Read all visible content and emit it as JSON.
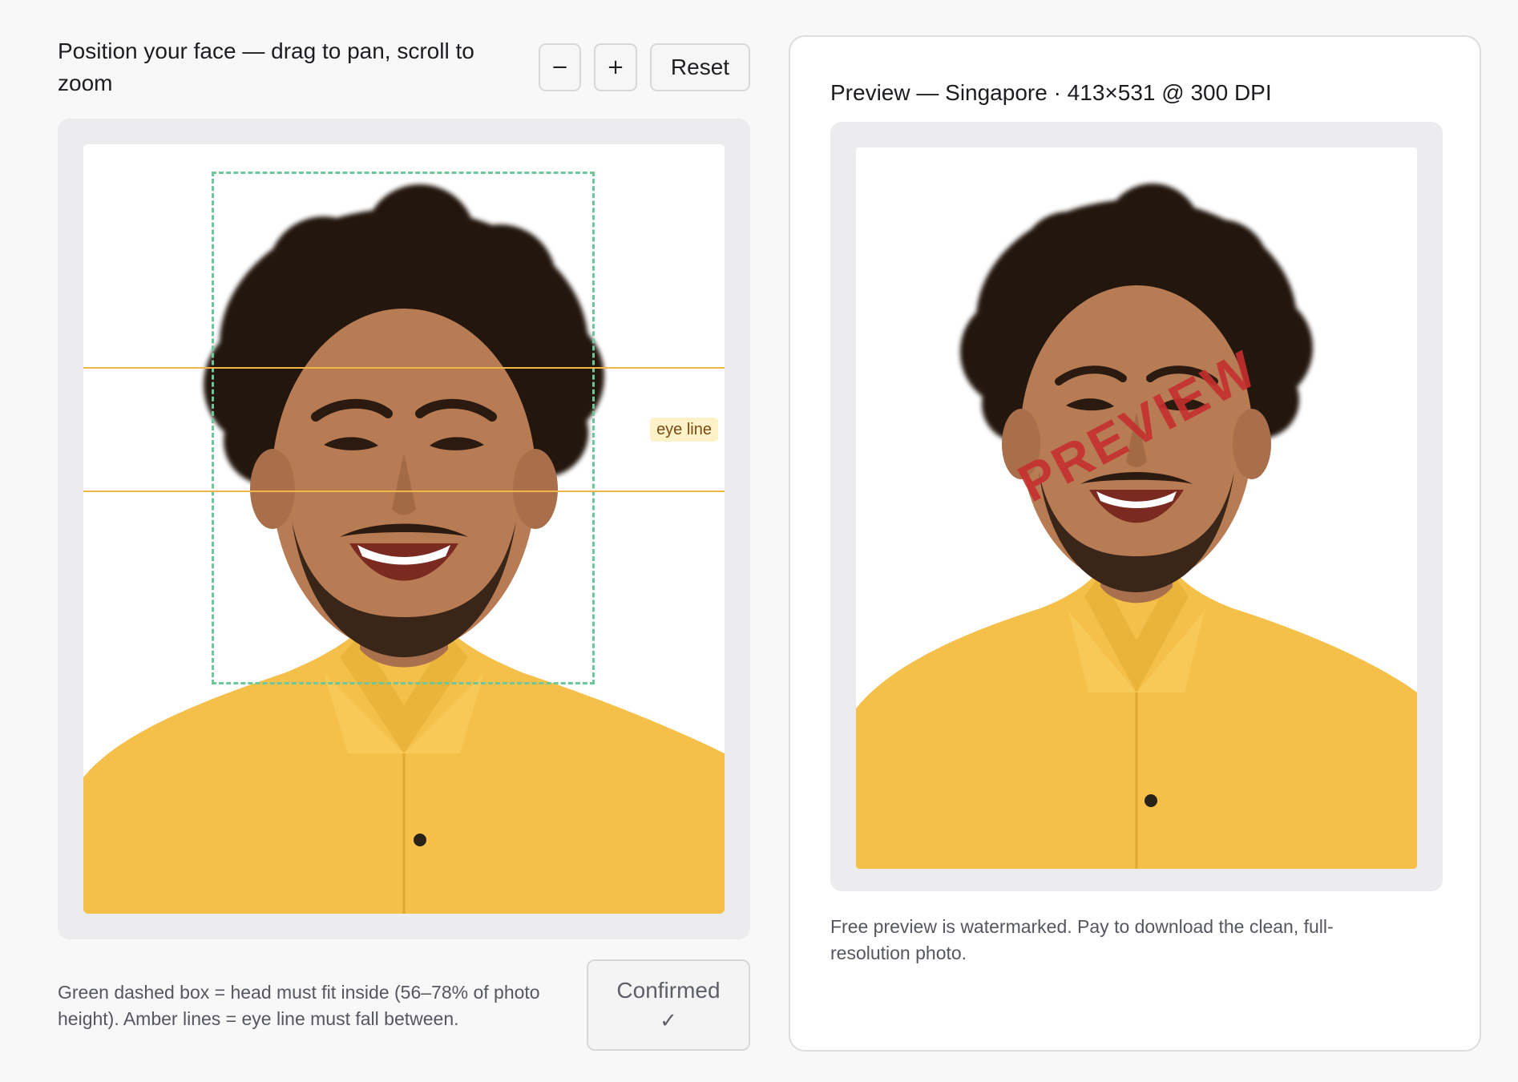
{
  "editor": {
    "title": "Position your face — drag to pan, scroll to zoom",
    "zoom_out_label": "−",
    "zoom_in_label": "+",
    "reset_label": "Reset",
    "eye_line_label": "eye line",
    "legend": "Green dashed box = head must fit inside (56–78% of photo height). Amber lines = eye line must fall between.",
    "confirm_label": "Confirmed",
    "confirm_check": "✓"
  },
  "preview": {
    "title": "Preview — Singapore · 413×531 @ 300 DPI",
    "watermark": "PREVIEW",
    "note": "Free preview is watermarked. Pay to download the clean, full-resolution photo."
  },
  "colors": {
    "head_box": "#6cc79a",
    "eye_lines": "#f0b449",
    "watermark": "#c62f2f",
    "shirt": "#f4c04a"
  },
  "icons": {
    "zoom_out": "minus-icon",
    "zoom_in": "plus-icon",
    "confirmed": "check-icon"
  }
}
